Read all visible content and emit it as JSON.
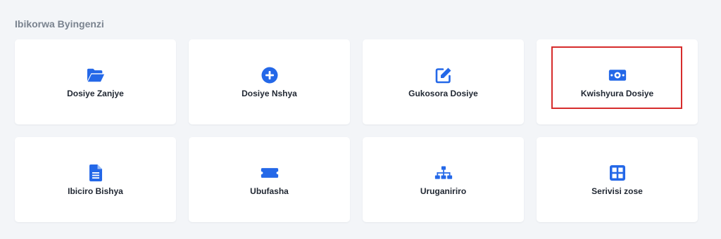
{
  "section": {
    "title": "Ibikorwa Byingenzi"
  },
  "colors": {
    "accent": "#2468e8",
    "highlight": "#d62c2c",
    "background": "#f3f5f8"
  },
  "cards": [
    {
      "label": "Dosiye Zanjye",
      "icon": "folder-open-icon"
    },
    {
      "label": "Dosiye Nshya",
      "icon": "plus-circle-icon"
    },
    {
      "label": "Gukosora Dosiye",
      "icon": "edit-icon"
    },
    {
      "label": "Kwishyura Dosiye",
      "icon": "money-bill-icon",
      "selected": true
    },
    {
      "label": "Ibiciro Bishya",
      "icon": "document-icon"
    },
    {
      "label": "Ubufasha",
      "icon": "ticket-icon"
    },
    {
      "label": "Uruganiriro",
      "icon": "sitemap-icon"
    },
    {
      "label": "Serivisi zose",
      "icon": "grid-icon"
    }
  ]
}
